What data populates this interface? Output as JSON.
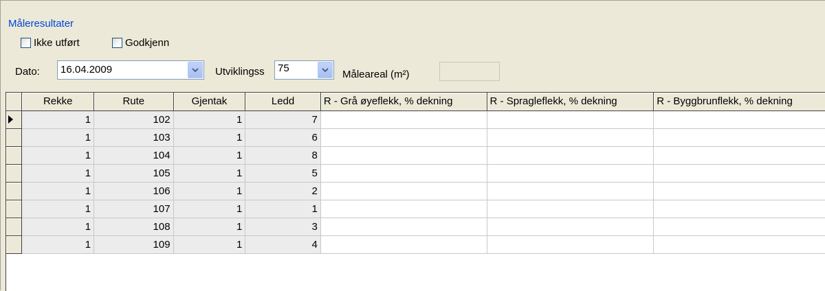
{
  "group": {
    "title": "Måleresultater"
  },
  "checkboxes": [
    {
      "label": "Ikke utført",
      "checked": false
    },
    {
      "label": "Godkjenn",
      "checked": false
    }
  ],
  "fields": {
    "dato_label": "Dato:",
    "dato_value": "16.04.2009",
    "utviklings_label": "Utviklingss",
    "utviklings_value": "75",
    "maleareal_label": "Måleareal (m²)",
    "maleareal_value": ""
  },
  "grid": {
    "columns": [
      "Rekke",
      "Rute",
      "Gjentak",
      "Ledd",
      "R - Grå øyeflekk, % dekning",
      "R - Spragleflekk, % dekning",
      "R - Byggbrunflekk, % dekning"
    ],
    "rows": [
      {
        "rekke": "1",
        "rute": "102",
        "gjentak": "1",
        "ledd": "7",
        "current": true
      },
      {
        "rekke": "1",
        "rute": "103",
        "gjentak": "1",
        "ledd": "6"
      },
      {
        "rekke": "1",
        "rute": "104",
        "gjentak": "1",
        "ledd": "8"
      },
      {
        "rekke": "1",
        "rute": "105",
        "gjentak": "1",
        "ledd": "5"
      },
      {
        "rekke": "1",
        "rute": "106",
        "gjentak": "1",
        "ledd": "2"
      },
      {
        "rekke": "1",
        "rute": "107",
        "gjentak": "1",
        "ledd": "1"
      },
      {
        "rekke": "1",
        "rute": "108",
        "gjentak": "1",
        "ledd": "3"
      },
      {
        "rekke": "1",
        "rute": "109",
        "gjentak": "1",
        "ledd": "4"
      }
    ]
  },
  "colors": {
    "group_title": "#0046d5",
    "background": "#ece9d8",
    "grid_line": "#c8c8c8"
  },
  "icons": {
    "row_pointer": "triangle-right-icon",
    "dropdown": "chevron-down-icon"
  }
}
